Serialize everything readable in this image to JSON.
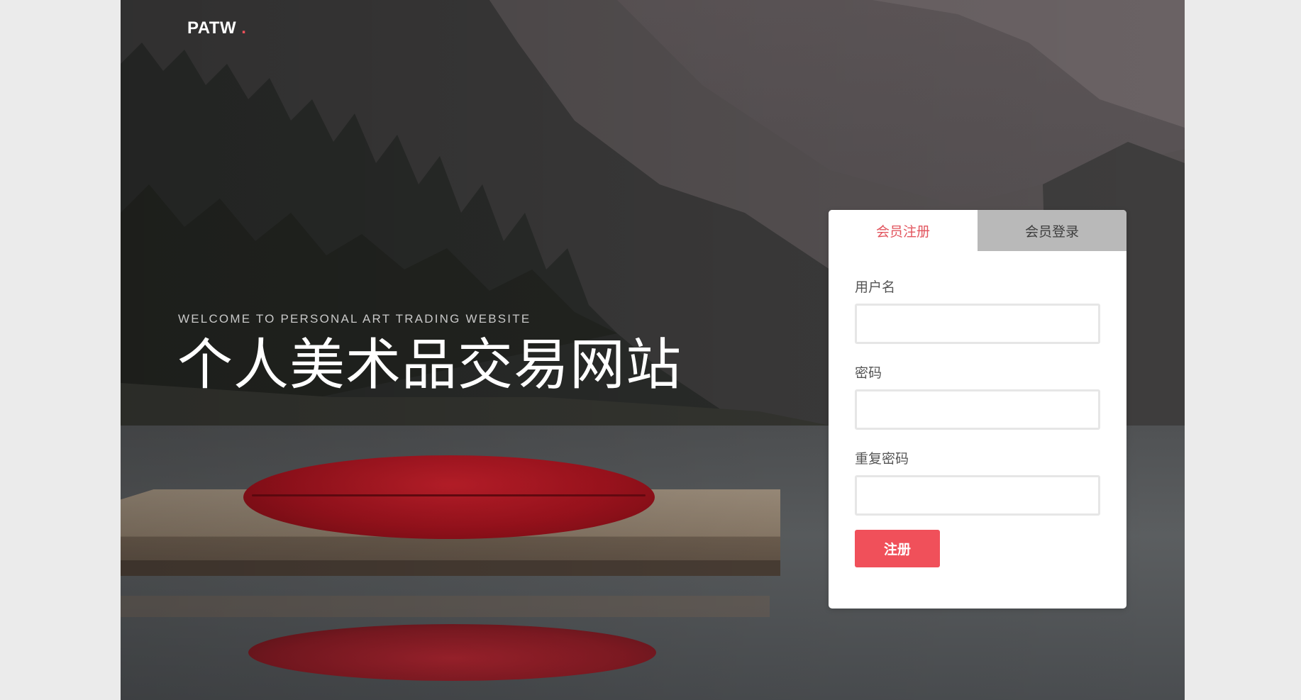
{
  "brand": {
    "name": "PATW",
    "dot": "."
  },
  "hero": {
    "subtitle": "WELCOME TO PERSONAL ART TRADING WEBSITE",
    "title": "个人美术品交易网站"
  },
  "auth_card": {
    "tabs": [
      {
        "label": "会员注册",
        "active": true
      },
      {
        "label": "会员登录",
        "active": false
      }
    ],
    "fields": {
      "username": {
        "label": "用户名",
        "value": ""
      },
      "password": {
        "label": "密码",
        "value": ""
      },
      "confirm_password": {
        "label": "重复密码",
        "value": ""
      }
    },
    "submit_label": "注册"
  },
  "colors": {
    "accent": "#f0505a",
    "active_tab_text": "#e2555e",
    "inactive_tab_bg": "#b9b9b9",
    "page_bg": "#ebebeb"
  }
}
